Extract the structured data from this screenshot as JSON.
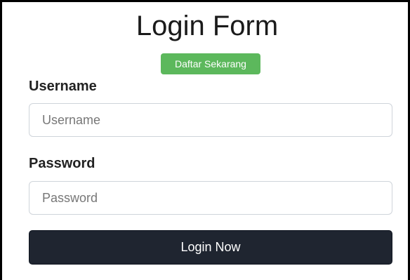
{
  "form": {
    "title": "Login Form",
    "register_label": "Daftar Sekarang",
    "username": {
      "label": "Username",
      "placeholder": "Username",
      "value": ""
    },
    "password": {
      "label": "Password",
      "placeholder": "Password",
      "value": ""
    },
    "submit_label": "Login Now"
  },
  "colors": {
    "register_button": "#5cb85c",
    "submit_button": "#1f2530",
    "input_border": "#cfd4da",
    "frame_border": "#000000"
  }
}
